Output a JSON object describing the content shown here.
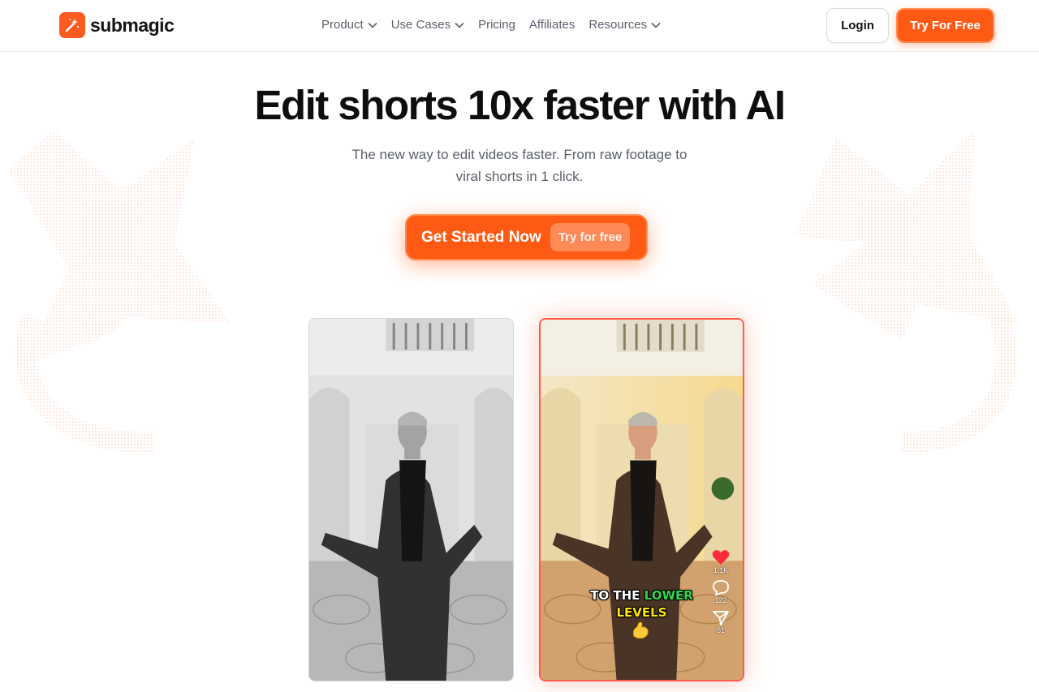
{
  "brand": {
    "name": "submagic",
    "accent": "#ff5a14"
  },
  "nav": {
    "items": [
      {
        "label": "Product",
        "dropdown": true
      },
      {
        "label": "Use Cases",
        "dropdown": true
      },
      {
        "label": "Pricing",
        "dropdown": false
      },
      {
        "label": "Affiliates",
        "dropdown": false
      },
      {
        "label": "Resources",
        "dropdown": true
      }
    ],
    "login_label": "Login",
    "try_label": "Try For Free"
  },
  "hero": {
    "title": "Edit shorts 10x faster with AI",
    "subtitle_line1": "The new way to edit videos faster. From raw footage to",
    "subtitle_line2": "viral shorts in 1 click.",
    "cta_label": "Get Started Now",
    "cta_pill": "Try for free"
  },
  "demo": {
    "caption_word1": "TO THE",
    "caption_word2": "LOWER",
    "caption_word3": "LEVELS",
    "likes": "1.1K",
    "comments": "122",
    "shares": "61",
    "icons": [
      "heart-icon",
      "comment-icon",
      "share-icon",
      "flexed-arm-emoji"
    ]
  }
}
